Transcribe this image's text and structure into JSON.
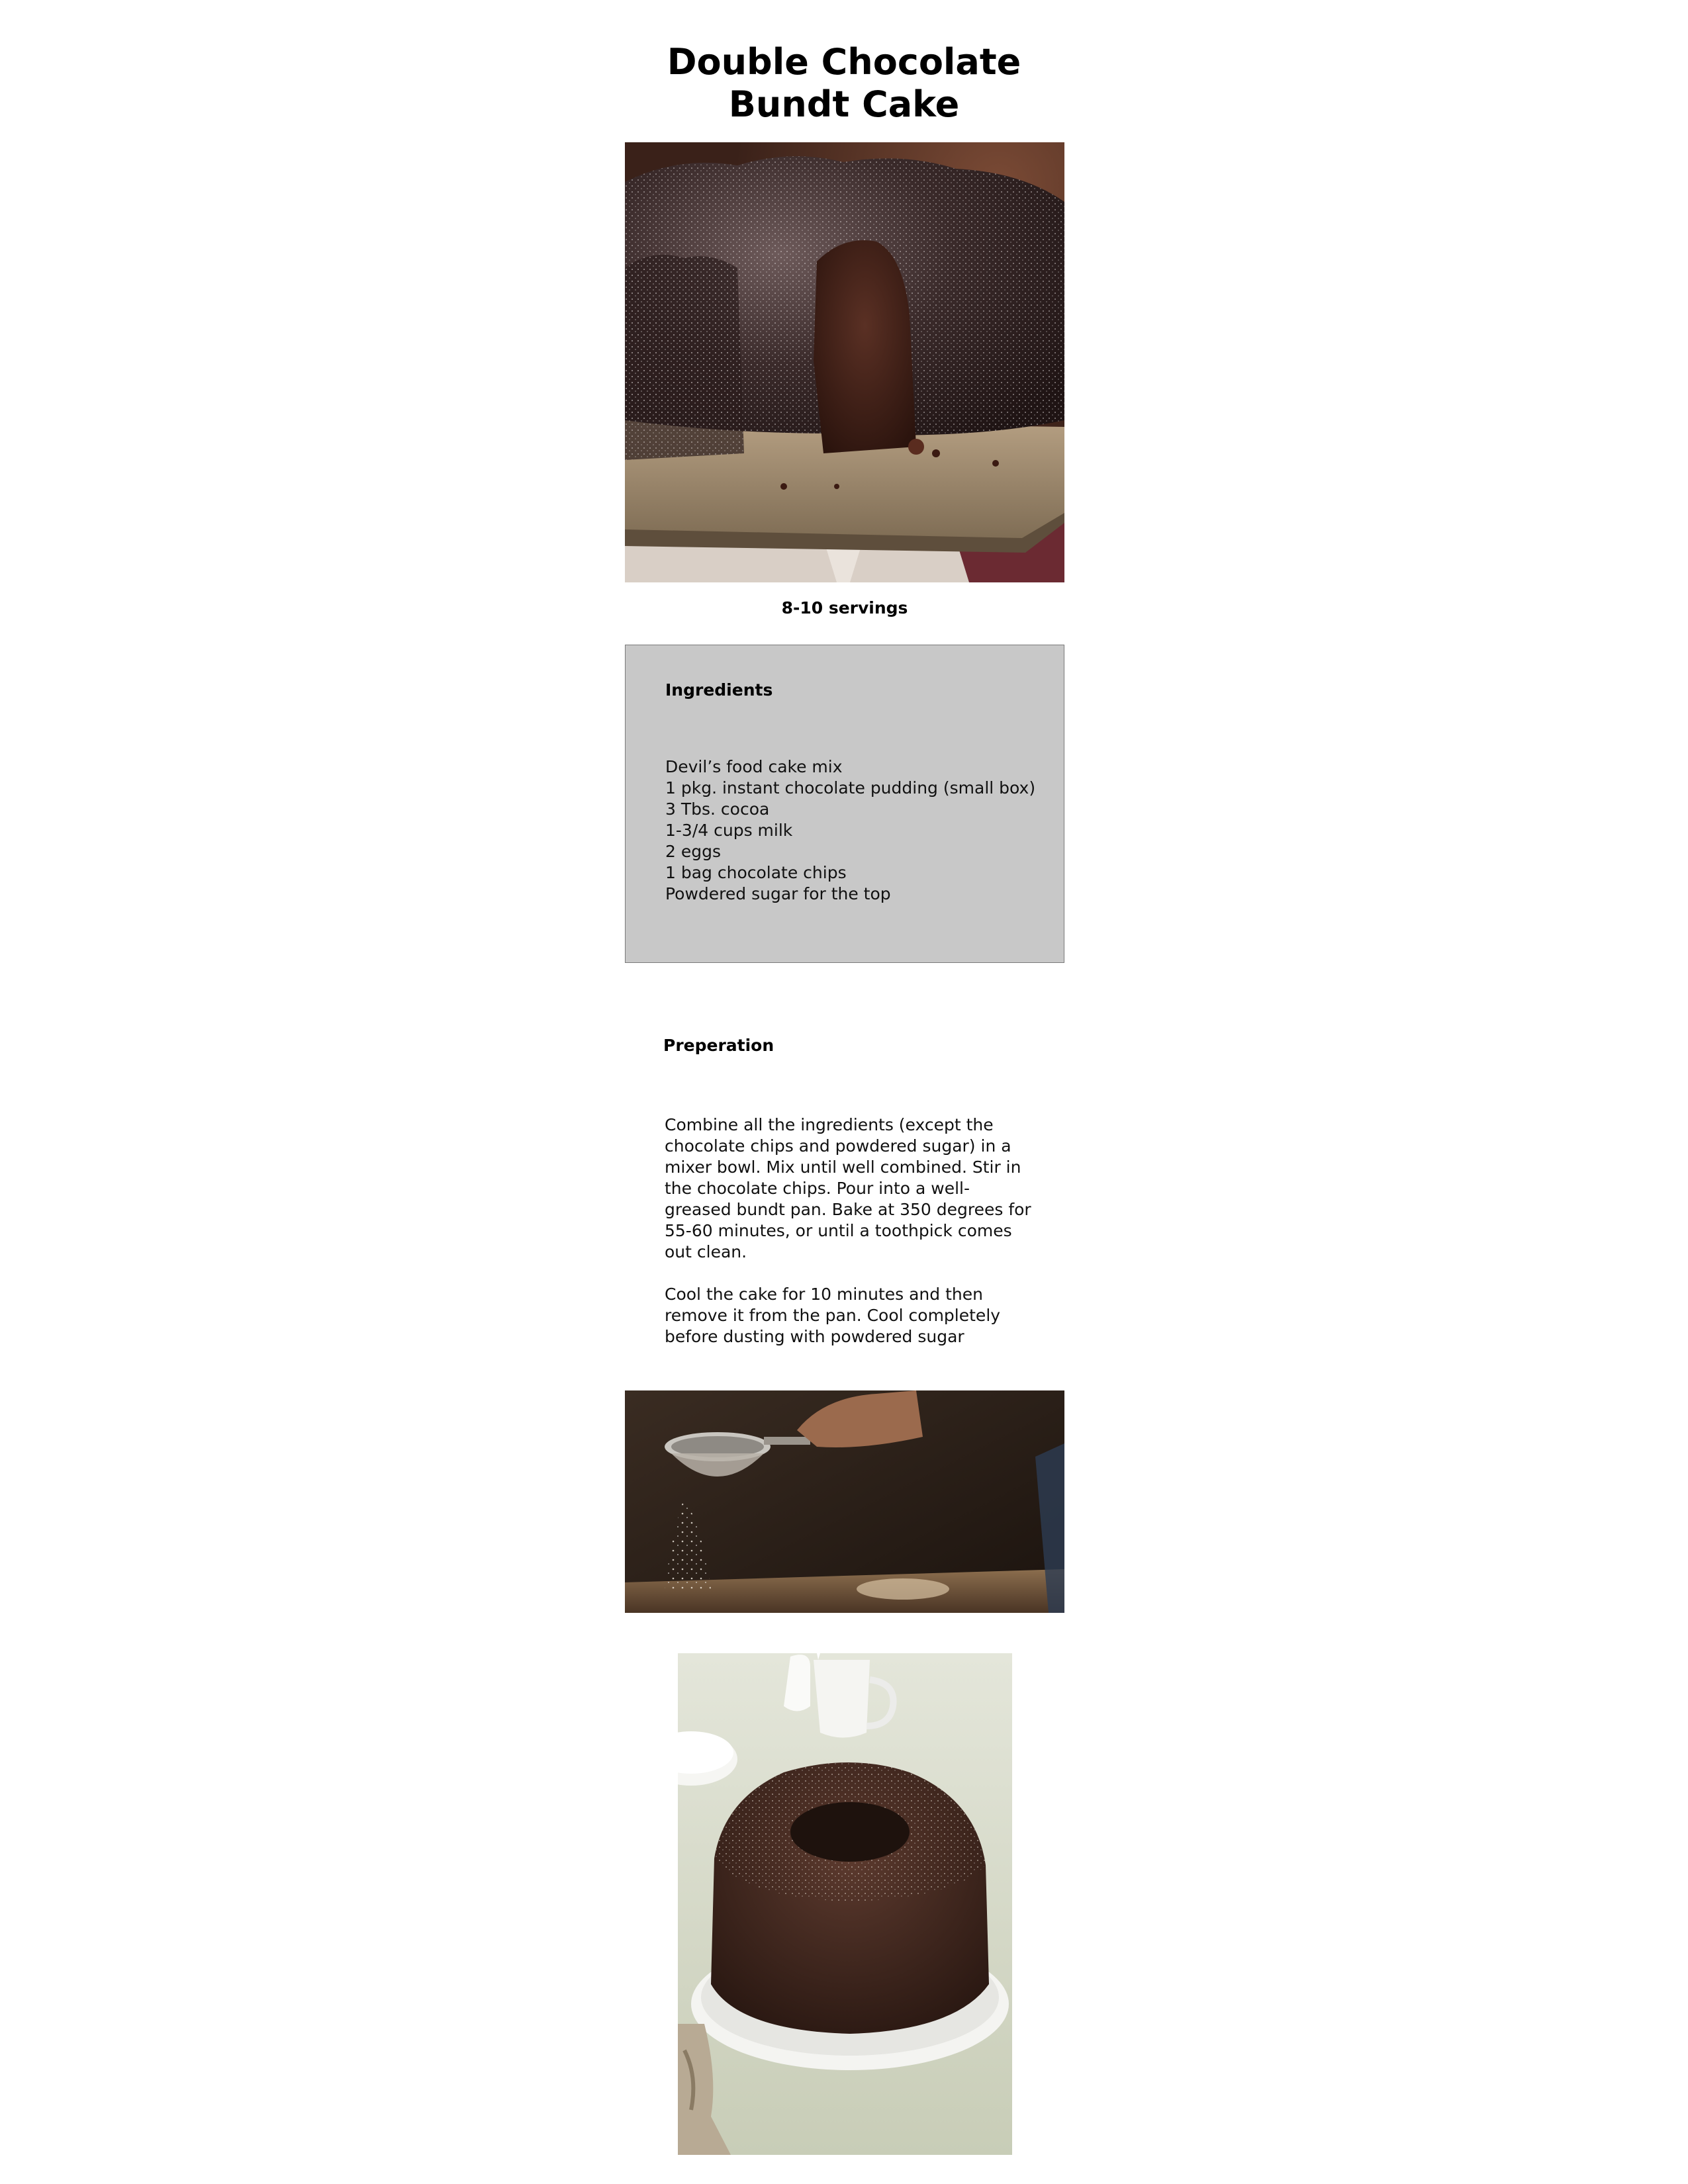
{
  "recipe": {
    "title_line1": "Double Chocolate",
    "title_line2": "Bundt Cake",
    "servings": "8-10 servings",
    "ingredients": {
      "heading": "Ingredients",
      "items": [
        "Devil’s food cake mix",
        "1 pkg. instant chocolate pudding (small box)",
        "3 Tbs. cocoa",
        "1-3/4 cups milk",
        "2 eggs",
        "1 bag chocolate chips",
        "Powdered sugar for the top"
      ]
    },
    "preparation": {
      "heading": "Preperation",
      "paragraphs": [
        "Combine all the ingredients (except the chocolate chips and powdered sugar) in a mixer bowl.  Mix until well combined.  Stir in the chocolate chips.  Pour into a well-greased bundt pan.  Bake at 350 degrees for 55-60 minutes, or until a toothpick comes out clean.",
        "Cool the cake for 10 minutes and then remove it from the pan.  Cool completely before dusting with powdered sugar"
      ]
    },
    "photos": {
      "top": "photo of a sliced chocolate bundt cake dusted with powdered sugar",
      "middle": "photo of a sifter dusting powdered sugar",
      "bottom": "photo of a whole chocolate bundt cake on a white plate"
    }
  },
  "colors": {
    "ingredients_box_bg": "#c8c8c8",
    "ingredients_box_border": "#7a7a7a",
    "text": "#111111"
  }
}
